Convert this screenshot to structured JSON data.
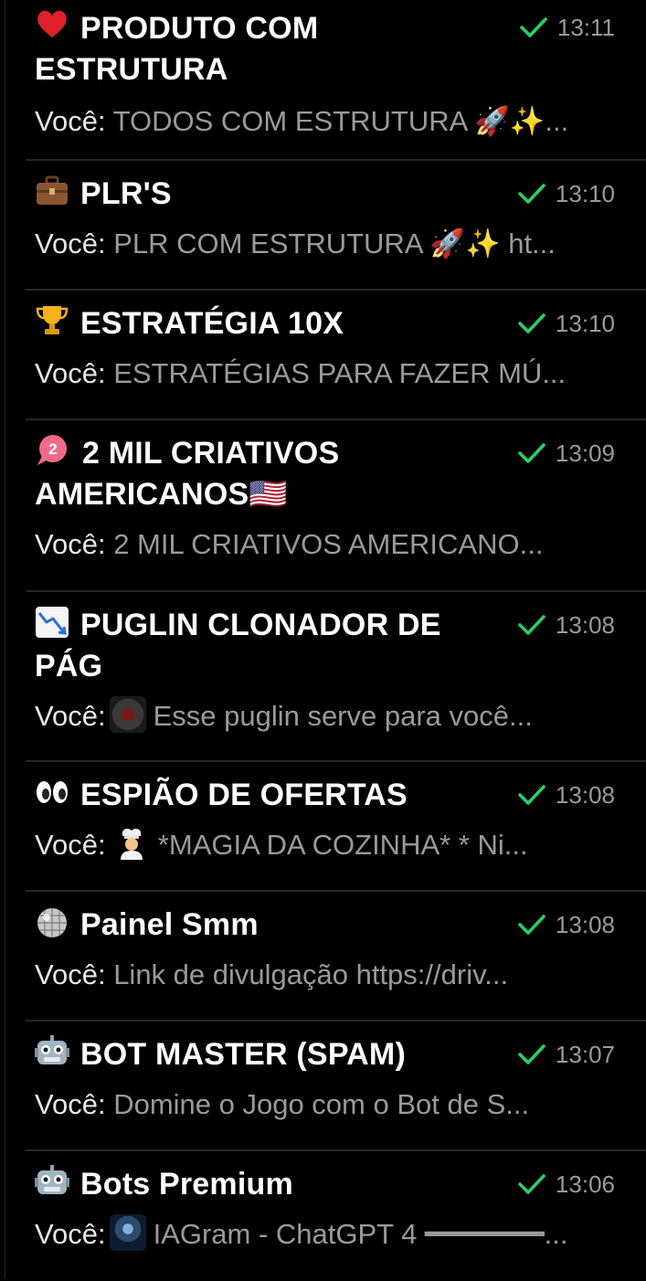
{
  "chats": [
    {
      "name": "PRODUTO COM ESTRUTURA",
      "icon": "heart-icon",
      "time": "13:11",
      "sender": "Você:",
      "preview": "TODOS COM ESTRUTURA 🚀✨..."
    },
    {
      "name": "PLR'S",
      "icon": "briefcase-icon",
      "time": "13:10",
      "sender": "Você:",
      "preview": "PLR COM ESTRUTURA 🚀✨  ht..."
    },
    {
      "name": "ESTRATÉGIA 10X",
      "icon": "trophy-icon",
      "time": "13:10",
      "sender": "Você:",
      "preview": "ESTRATÉGIAS PARA FAZER MÚ..."
    },
    {
      "name": "2 MIL CRIATIVOS AMERICANOS🇺🇸",
      "icon": "speech-bubble-2-icon",
      "time": "13:09",
      "sender": "Você:",
      "preview": "2 MIL CRIATIVOS AMERICANO..."
    },
    {
      "name": "PUGLIN CLONADOR DE PÁG",
      "icon": "chart-decreasing-icon",
      "time": "13:08",
      "sender": "Você:",
      "preview": "Esse puglin serve para você..."
    },
    {
      "name": "ESPIÃO DE OFERTAS",
      "icon": "eyes-icon",
      "time": "13:08",
      "sender": "Você:",
      "preview": " *MAGIA DA COZINHA* * Ni..."
    },
    {
      "name": "Painel Smm",
      "icon": "disco-ball-icon",
      "time": "13:08",
      "sender": "Você:",
      "preview": "Link de divulgação  https://driv..."
    },
    {
      "name": "BOT MASTER (SPAM)",
      "icon": "robot-icon",
      "time": "13:07",
      "sender": "Você:",
      "preview": "Domine o Jogo com o Bot de S..."
    },
    {
      "name": "Bots Premium",
      "icon": "robot-icon",
      "time": "13:06",
      "sender": "Você:",
      "preview": "IAGram - ChatGPT 4 ━━━━━━━..."
    }
  ],
  "colors": {
    "background": "#000000",
    "check": "#25d366",
    "muted_text": "#9a9a9a",
    "divider": "#262626"
  }
}
